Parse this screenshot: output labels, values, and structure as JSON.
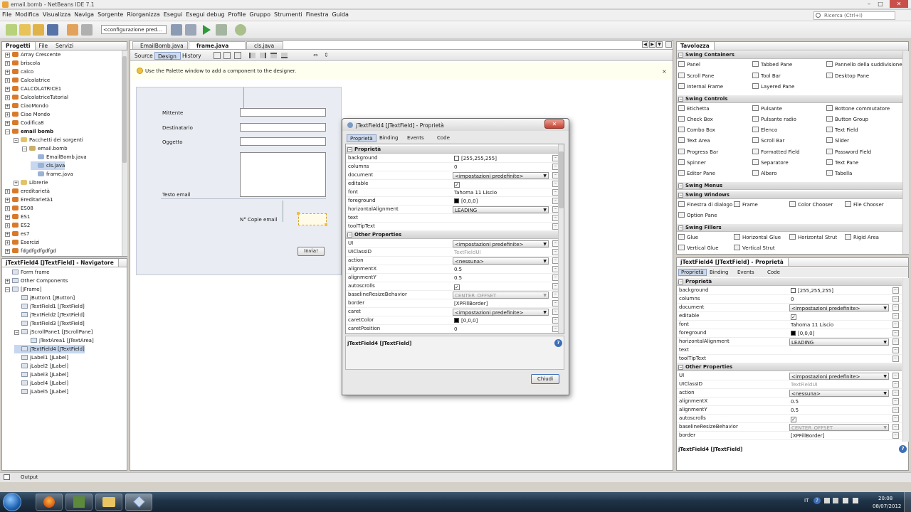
{
  "window": {
    "title": "email.bomb - NetBeans IDE 7.1"
  },
  "menu": [
    "File",
    "Modifica",
    "Visualizza",
    "Naviga",
    "Sorgente",
    "Riorganizza",
    "Esegui",
    "Esegui debug",
    "Profile",
    "Gruppo",
    "Strumenti",
    "Finestra",
    "Guida"
  ],
  "search": {
    "placeholder": "Ricerca (Ctrl+I)"
  },
  "toolbar": {
    "config": "<configurazione pred..."
  },
  "projects": {
    "tabs": [
      "Progetti",
      "File",
      "Servizi"
    ],
    "items": [
      "Array Crescente",
      "briscola",
      "calco",
      "Calcolatrice",
      "CALCOLATRICE1",
      "CalcolatriceTutorial",
      "CiaoMondo",
      "Ciao Mondo",
      "Codifica8",
      "email bomb",
      "Pacchetti dei sorgenti",
      "email.bomb",
      "EmailBomb.java",
      "cls.java",
      "frame.java",
      "Librerie",
      "ereditarietà",
      "Ereditarietà1",
      "ES08",
      "ES1",
      "ES2",
      "es7",
      "Esercizi",
      "fdgdfgdfgdfgd"
    ]
  },
  "navigator": {
    "title": "jTextField4 [JTextField] - Navigatore",
    "items": [
      "Form frame",
      "Other Components",
      "[JFrame]",
      "jButton1 [JButton]",
      "jTextField1 [JTextField]",
      "jTextField2 [JTextField]",
      "jTextField3 [JTextField]",
      "jScrollPane1 [JScrollPane]",
      "jTextArea1 [JTextArea]",
      "jTextField4 [JTextField]",
      "jLabel1 [JLabel]",
      "jLabel2 [JLabel]",
      "jLabel3 [JLabel]",
      "jLabel4 [JLabel]",
      "jLabel5 [JLabel]"
    ]
  },
  "editor": {
    "tabs": [
      "EmailBomb.java",
      "frame.java",
      "cls.java"
    ],
    "subtabs": [
      "Source",
      "Design",
      "History"
    ],
    "hint": "Use the Palette window to add a component to the designer.",
    "form": {
      "mittente": "Mittente",
      "destinatario": "Destinatario",
      "oggetto": "Oggetto",
      "testo": "Testo email",
      "copie": "N° Copie email",
      "invia": "Invia!"
    }
  },
  "dialog": {
    "title": "jTextField4 [JTextField] - Proprietà",
    "tabs": [
      "Proprietà",
      "Binding",
      "Events",
      "Code"
    ],
    "section1": "Proprietà",
    "section2": "Other Properties",
    "footer_title": "jTextField4 [JTextField]",
    "close": "Chiudi",
    "props1": [
      {
        "k": "background",
        "v": "[255,255,255]",
        "type": "color",
        "c": "#ffffff"
      },
      {
        "k": "columns",
        "v": "0",
        "type": "text"
      },
      {
        "k": "document",
        "v": "<impostazioni predefinite>",
        "type": "combo"
      },
      {
        "k": "editable",
        "v": "✓",
        "type": "check"
      },
      {
        "k": "font",
        "v": "Tahoma 11 Liscio",
        "type": "text"
      },
      {
        "k": "foreground",
        "v": "[0,0,0]",
        "type": "color",
        "c": "#000000"
      },
      {
        "k": "horizontalAlignment",
        "v": "LEADING",
        "type": "combo"
      },
      {
        "k": "text",
        "v": "",
        "type": "text"
      },
      {
        "k": "toolTipText",
        "v": "",
        "type": "text"
      }
    ],
    "props2": [
      {
        "k": "UI",
        "v": "<impostazioni predefinite>",
        "type": "combo"
      },
      {
        "k": "UIClassID",
        "v": "TextFieldUI",
        "type": "grey"
      },
      {
        "k": "action",
        "v": "<nessuna>",
        "type": "combo"
      },
      {
        "k": "alignmentX",
        "v": "0.5",
        "type": "text"
      },
      {
        "k": "alignmentY",
        "v": "0.5",
        "type": "text"
      },
      {
        "k": "autoscrolls",
        "v": "✓",
        "type": "check"
      },
      {
        "k": "baselineResizeBehavior",
        "v": "CENTER_OFFSET",
        "type": "greycombo"
      },
      {
        "k": "border",
        "v": "[XPFillBorder]",
        "type": "text"
      },
      {
        "k": "caret",
        "v": "<impostazioni predefinite>",
        "type": "combo"
      },
      {
        "k": "caretColor",
        "v": "[0,0,0]",
        "type": "color",
        "c": "#000000"
      },
      {
        "k": "caretPosition",
        "v": "0",
        "type": "text"
      }
    ]
  },
  "palette": {
    "title": "Tavolozza",
    "cats": {
      "containers": "Swing Containers",
      "controls": "Swing Controls",
      "menus": "Swing Menus",
      "windows": "Swing Windows",
      "fillers": "Swing Fillers",
      "awt": "AWT"
    },
    "containers": [
      "Panel",
      "Tabbed Pane",
      "Pannello della suddivisione",
      "Scroll Pane",
      "Tool Bar",
      "Desktop Pane",
      "Internal Frame",
      "Layered Pane"
    ],
    "controls": [
      "Etichetta",
      "Pulsante",
      "Bottone commutatore",
      "Check Box",
      "Pulsante radio",
      "Button Group",
      "Combo Box",
      "Elenco",
      "Text Field",
      "Text Area",
      "Scroll Bar",
      "Slider",
      "Progress Bar",
      "Formatted Field",
      "Password Field",
      "Spinner",
      "Separatore",
      "Text Pane",
      "Editor Pane",
      "Albero",
      "Tabella"
    ],
    "windows": [
      "Finestra di dialogo",
      "Frame",
      "Color Chooser",
      "File Chooser",
      "Option Pane"
    ],
    "fillers": [
      "Glue",
      "Horizontal Glue",
      "Horizontal Strut",
      "Rigid Area",
      "Vertical Glue",
      "Vertical Strut"
    ],
    "awt": [
      "Etichetta",
      "Pulsante",
      "Text Field"
    ]
  },
  "props_panel": {
    "title": "jTextField4 [JTextField] - Proprietà",
    "tabs": [
      "Proprietà",
      "Binding",
      "Events",
      "Code"
    ],
    "section1": "Proprietà",
    "section2": "Other Properties",
    "footer": "jTextField4 [JTextField]",
    "props1": [
      {
        "k": "background",
        "v": "[255,255,255]",
        "type": "color",
        "c": "#ffffff"
      },
      {
        "k": "columns",
        "v": "0",
        "type": "text"
      },
      {
        "k": "document",
        "v": "<impostazioni predefinite>",
        "type": "combo"
      },
      {
        "k": "editable",
        "v": "✓",
        "type": "check"
      },
      {
        "k": "font",
        "v": "Tahoma 11 Liscio",
        "type": "text"
      },
      {
        "k": "foreground",
        "v": "[0,0,0]",
        "type": "color",
        "c": "#000000"
      },
      {
        "k": "horizontalAlignment",
        "v": "LEADING",
        "type": "combo"
      },
      {
        "k": "text",
        "v": "",
        "type": "text"
      },
      {
        "k": "toolTipText",
        "v": "",
        "type": "text"
      }
    ],
    "props2": [
      {
        "k": "UI",
        "v": "<impostazioni predefinite>",
        "type": "combo"
      },
      {
        "k": "UIClassID",
        "v": "TextFieldUI",
        "type": "grey"
      },
      {
        "k": "action",
        "v": "<nessuna>",
        "type": "combo"
      },
      {
        "k": "alignmentX",
        "v": "0.5",
        "type": "text"
      },
      {
        "k": "alignmentY",
        "v": "0.5",
        "type": "text"
      },
      {
        "k": "autoscrolls",
        "v": "✓",
        "type": "check"
      },
      {
        "k": "baselineResizeBehavior",
        "v": "CENTER_OFFSET",
        "type": "greycombo"
      },
      {
        "k": "border",
        "v": "[XPFillBorder]",
        "type": "text"
      }
    ]
  },
  "output": {
    "label": "Output"
  },
  "taskbar": {
    "lang": "IT",
    "time": "20:08",
    "date": "08/07/2012"
  }
}
